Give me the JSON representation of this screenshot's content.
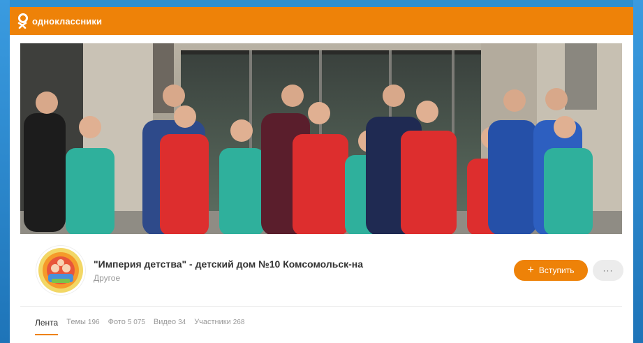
{
  "site": {
    "logo_text": "одноклассники"
  },
  "group": {
    "title": "\"Империя детства\" - детский дом №10 Комсомольск-на",
    "category": "Другое",
    "join_label": "Вступить",
    "more_label": "···"
  },
  "tabs": [
    {
      "label": "Лента",
      "count": "",
      "active": true
    },
    {
      "label": "Темы",
      "count": "196"
    },
    {
      "label": "Фото",
      "count": "5 075"
    },
    {
      "label": "Видео",
      "count": "34"
    },
    {
      "label": "Участники",
      "count": "268"
    }
  ],
  "colors": {
    "brand": "#ee8208",
    "background": "#2d8fd0"
  },
  "icons": {
    "logo": "ok-logo-icon",
    "join": "plus-icon",
    "more": "more-dots-icon"
  }
}
